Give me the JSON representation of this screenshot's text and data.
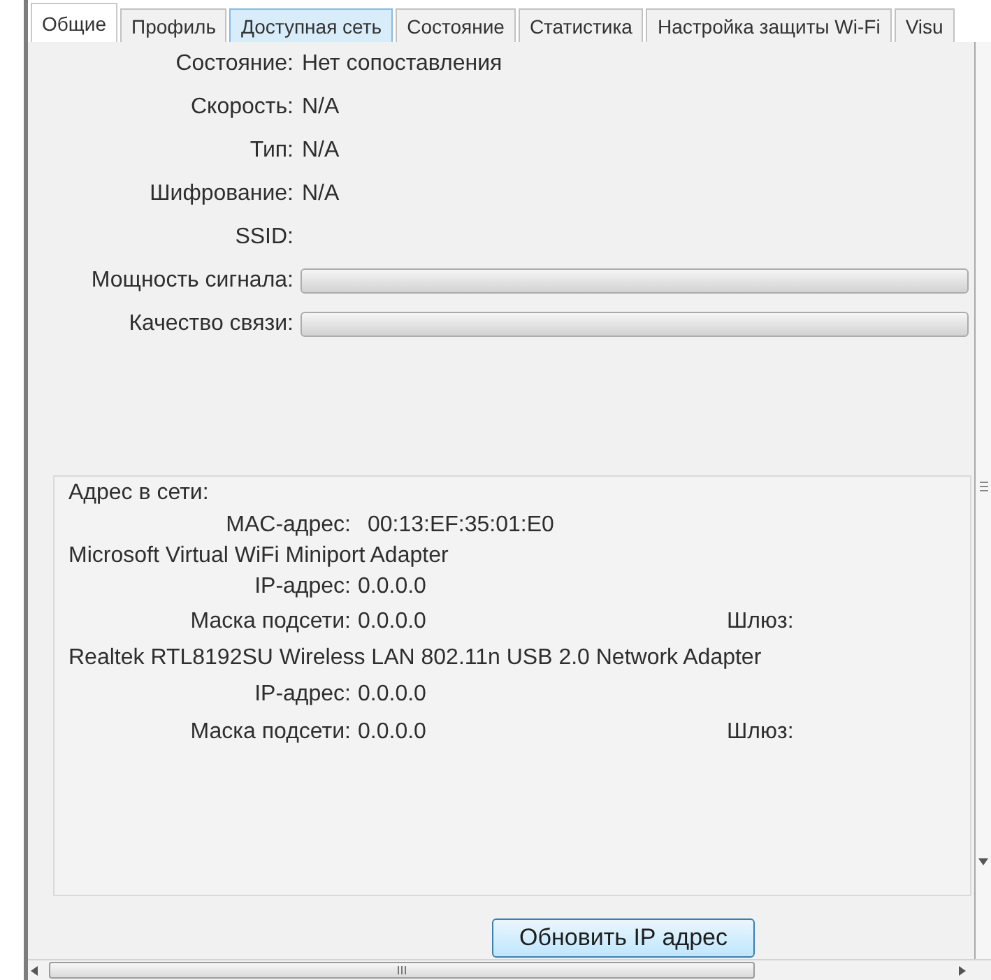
{
  "tabs": [
    {
      "label": "Общие",
      "selected": true,
      "hovered": false
    },
    {
      "label": "Профиль",
      "selected": false,
      "hovered": false
    },
    {
      "label": "Доступная сеть",
      "selected": false,
      "hovered": true
    },
    {
      "label": "Состояние",
      "selected": false,
      "hovered": false
    },
    {
      "label": "Статистика",
      "selected": false,
      "hovered": false
    },
    {
      "label": "Настройка защиты Wi-Fi",
      "selected": false,
      "hovered": false
    },
    {
      "label": "Visu",
      "selected": false,
      "hovered": false
    }
  ],
  "status_fields": [
    {
      "label": "Состояние:",
      "value": "Нет сопоставления"
    },
    {
      "label": "Скорость:",
      "value": "N/A"
    },
    {
      "label": "Тип:",
      "value": "N/A"
    },
    {
      "label": "Шифрование:",
      "value": "N/A"
    },
    {
      "label": "SSID:"
    }
  ],
  "meters": [
    {
      "label": "Мощность сигнала:",
      "level": 0
    },
    {
      "label": "Качество связи:",
      "level": 0
    }
  ],
  "network_addresses": {
    "title": "Адрес в сети:",
    "mac_address": {
      "label": "MAC-адрес:",
      "value": "00:13:EF:35:01:E0"
    },
    "adapters": [
      {
        "name": "Microsoft Virtual WiFi Miniport Adapter",
        "ip": {
          "label": "IP-адрес:",
          "value": "0.0.0.0"
        },
        "mask": {
          "label": "Маска подсети:",
          "value": "0.0.0.0"
        },
        "gateway": {
          "label": "Шлюз:"
        }
      },
      {
        "name": "Realtek RTL8192SU Wireless LAN 802.11n USB 2.0 Network Adapter",
        "ip": {
          "label": "IP-адрес:",
          "value": "0.0.0.0"
        },
        "mask": {
          "label": "Маска подсети:",
          "value": "0.0.0.0"
        },
        "gateway": {
          "label": "Шлюз:"
        }
      }
    ]
  },
  "refresh_button": "Обновить IP адрес"
}
